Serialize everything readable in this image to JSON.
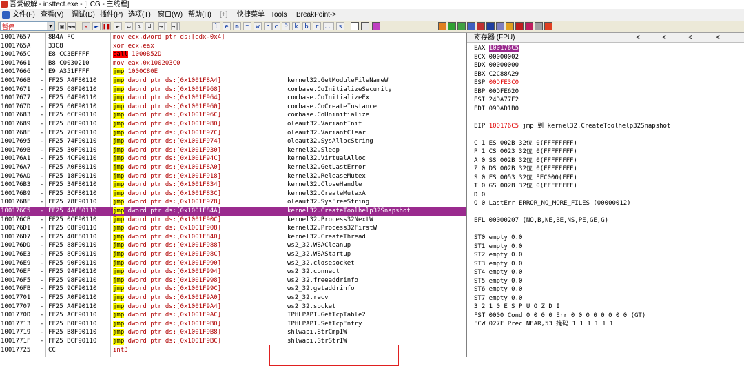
{
  "window": {
    "title": "吾爱破解 - insttect.exe - [LCG - 主线程]"
  },
  "menu": [
    "文件(F)",
    "查看(V)",
    "调试(D)",
    "插件(P)",
    "选项(T)",
    "窗口(W)",
    "帮助(H)",
    "[+]",
    "快捷菜单",
    "Tools",
    "BreakPoint->"
  ],
  "toolbar": {
    "combo_value": "暂停",
    "buttons": [
      "◄◄",
      "✕",
      "►",
      "❚❚",
      "►",
      "↵",
      "↴",
      "↲",
      "→|",
      "→|"
    ],
    "letter_buttons": [
      "l",
      "e",
      "m",
      "t",
      "w",
      "h",
      "c",
      "P",
      "k",
      "b",
      "r",
      "...",
      "s"
    ]
  },
  "code": {
    "rows": [
      {
        "addr": "10017657",
        "mk": "",
        "hex": "8B4A FC",
        "op": "mov",
        "args": " ecx,dword ptr ds:[edx-0x4]",
        "cmt": "",
        "op_class": "mov"
      },
      {
        "addr": "1001765A",
        "mk": "",
        "hex": "33C8",
        "op": "xor",
        "args": " ecx,eax",
        "cmt": "",
        "op_class": "mov"
      },
      {
        "addr": "1001765C",
        "mk": "",
        "hex": "E8 CC3EFFFF",
        "op": "call",
        "args": " 1000B52D",
        "cmt": "",
        "op_class": "call"
      },
      {
        "addr": "10017661",
        "mk": "",
        "hex": "B8 C0030210",
        "op": "mov",
        "args": " eax,0x100203C0",
        "cmt": "",
        "op_class": "mov"
      },
      {
        "addr": "10017666",
        "mk": "^",
        "hex": "E9 A351FFFF",
        "op": "jmp",
        "args": " 1000C80E",
        "cmt": "",
        "op_class": "jmp"
      },
      {
        "addr": "1001766B",
        "mk": "-",
        "hex": "FF25 A4F80110",
        "op": "jmp",
        "args": " dword ptr ds:[0x1001F8A4]",
        "cmt": "kernel32.GetModuleFileNameW",
        "op_class": "jmp"
      },
      {
        "addr": "10017671",
        "mk": "-",
        "hex": "FF25 68F90110",
        "op": "jmp",
        "args": " dword ptr ds:[0x1001F968]",
        "cmt": "combase.CoInitializeSecurity",
        "op_class": "jmp"
      },
      {
        "addr": "10017677",
        "mk": "-",
        "hex": "FF25 64F90110",
        "op": "jmp",
        "args": " dword ptr ds:[0x1001F964]",
        "cmt": "combase.CoInitializeEx",
        "op_class": "jmp"
      },
      {
        "addr": "1001767D",
        "mk": "-",
        "hex": "FF25 60F90110",
        "op": "jmp",
        "args": " dword ptr ds:[0x1001F960]",
        "cmt": "combase.CoCreateInstance",
        "op_class": "jmp"
      },
      {
        "addr": "10017683",
        "mk": "-",
        "hex": "FF25 6CF90110",
        "op": "jmp",
        "args": " dword ptr ds:[0x1001F96C]",
        "cmt": "combase.CoUninitialize",
        "op_class": "jmp"
      },
      {
        "addr": "10017689",
        "mk": "-",
        "hex": "FF25 80F90110",
        "op": "jmp",
        "args": " dword ptr ds:[0x1001F980]",
        "cmt": "oleaut32.VariantInit",
        "op_class": "jmp"
      },
      {
        "addr": "1001768F",
        "mk": "-",
        "hex": "FF25 7CF90110",
        "op": "jmp",
        "args": " dword ptr ds:[0x1001F97C]",
        "cmt": "oleaut32.VariantClear",
        "op_class": "jmp"
      },
      {
        "addr": "10017695",
        "mk": "-",
        "hex": "FF25 74F90110",
        "op": "jmp",
        "args": " dword ptr ds:[0x1001F974]",
        "cmt": "oleaut32.SysAllocString",
        "op_class": "jmp"
      },
      {
        "addr": "1001769B",
        "mk": "-",
        "hex": "FF25 30F90110",
        "op": "jmp",
        "args": " dword ptr ds:[0x1001F930]",
        "cmt": "kernel32.Sleep",
        "op_class": "jmp"
      },
      {
        "addr": "100176A1",
        "mk": "-",
        "hex": "FF25 4CF90110",
        "op": "jmp",
        "args": " dword ptr ds:[0x1001F94C]",
        "cmt": "kernel32.VirtualAlloc",
        "op_class": "jmp"
      },
      {
        "addr": "100176A7",
        "mk": "-",
        "hex": "FF25 A0F80110",
        "op": "jmp",
        "args": " dword ptr ds:[0x1001F8A0]",
        "cmt": "kernel32.GetLastError",
        "op_class": "jmp"
      },
      {
        "addr": "100176AD",
        "mk": "-",
        "hex": "FF25 18F90110",
        "op": "jmp",
        "args": " dword ptr ds:[0x1001F918]",
        "cmt": "kernel32.ReleaseMutex",
        "op_class": "jmp"
      },
      {
        "addr": "100176B3",
        "mk": "-",
        "hex": "FF25 34F80110",
        "op": "jmp",
        "args": " dword ptr ds:[0x1001F834]",
        "cmt": "kernel32.CloseHandle",
        "op_class": "jmp"
      },
      {
        "addr": "100176B9",
        "mk": "-",
        "hex": "FF25 3CF80110",
        "op": "jmp",
        "args": " dword ptr ds:[0x1001F83C]",
        "cmt": "kernel32.CreateMutexA",
        "op_class": "jmp"
      },
      {
        "addr": "100176BF",
        "mk": "-",
        "hex": "FF25 78F90110",
        "op": "jmp",
        "args": " dword ptr ds:[0x1001F978]",
        "cmt": "oleaut32.SysFreeString",
        "op_class": "jmp"
      },
      {
        "addr": "100176C5",
        "mk": "-",
        "hex": "FF25 4AF80110",
        "op": "jmp",
        "args": " dword ptr ds:[0x1001F84A]",
        "cmt": "kernel32.CreateToolhelp32Snapshot",
        "op_class": "jmp",
        "selected": true
      },
      {
        "addr": "100176CB",
        "mk": "-",
        "hex": "FF25 0CF90110",
        "op": "jmp",
        "args": " dword ptr ds:[0x1001F90C]",
        "cmt": "kernel32.Process32NextW",
        "op_class": "jmp"
      },
      {
        "addr": "100176D1",
        "mk": "-",
        "hex": "FF25 08F90110",
        "op": "jmp",
        "args": " dword ptr ds:[0x1001F908]",
        "cmt": "kernel32.Process32FirstW",
        "op_class": "jmp"
      },
      {
        "addr": "100176D7",
        "mk": "-",
        "hex": "FF25 40F80110",
        "op": "jmp",
        "args": " dword ptr ds:[0x1001F840]",
        "cmt": "kernel32.CreateThread",
        "op_class": "jmp"
      },
      {
        "addr": "100176DD",
        "mk": "-",
        "hex": "FF25 88F90110",
        "op": "jmp",
        "args": " dword ptr ds:[0x1001F988]",
        "cmt": "ws2_32.WSACleanup",
        "op_class": "jmp"
      },
      {
        "addr": "100176E3",
        "mk": "-",
        "hex": "FF25 8CF90110",
        "op": "jmp",
        "args": " dword ptr ds:[0x1001F98C]",
        "cmt": "ws2_32.WSAStartup",
        "op_class": "jmp"
      },
      {
        "addr": "100176E9",
        "mk": "-",
        "hex": "FF25 90F90110",
        "op": "jmp",
        "args": " dword ptr ds:[0x1001F990]",
        "cmt": "ws2_32.closesocket",
        "op_class": "jmp"
      },
      {
        "addr": "100176EF",
        "mk": "-",
        "hex": "FF25 94F90110",
        "op": "jmp",
        "args": " dword ptr ds:[0x1001F994]",
        "cmt": "ws2_32.connect",
        "op_class": "jmp"
      },
      {
        "addr": "100176F5",
        "mk": "-",
        "hex": "FF25 98F90110",
        "op": "jmp",
        "args": " dword ptr ds:[0x1001F998]",
        "cmt": "ws2_32.freeaddrinfo",
        "op_class": "jmp"
      },
      {
        "addr": "100176FB",
        "mk": "-",
        "hex": "FF25 9CF90110",
        "op": "jmp",
        "args": " dword ptr ds:[0x1001F99C]",
        "cmt": "ws2_32.getaddrinfo",
        "op_class": "jmp"
      },
      {
        "addr": "10017701",
        "mk": "-",
        "hex": "FF25 A0F90110",
        "op": "jmp",
        "args": " dword ptr ds:[0x1001F9A0]",
        "cmt": "ws2_32.recv",
        "op_class": "jmp"
      },
      {
        "addr": "10017707",
        "mk": "-",
        "hex": "FF25 A4F90110",
        "op": "jmp",
        "args": " dword ptr ds:[0x1001F9A4]",
        "cmt": "ws2_32.socket",
        "op_class": "jmp"
      },
      {
        "addr": "1001770D",
        "mk": "-",
        "hex": "FF25 ACF90110",
        "op": "jmp",
        "args": " dword ptr ds:[0x1001F9AC]",
        "cmt": "IPHLPAPI.GetTcpTable2",
        "op_class": "jmp"
      },
      {
        "addr": "10017713",
        "mk": "-",
        "hex": "FF25 B0F90110",
        "op": "jmp",
        "args": " dword ptr ds:[0x1001F9B0]",
        "cmt": "IPHLPAPI.SetTcpEntry",
        "op_class": "jmp"
      },
      {
        "addr": "10017719",
        "mk": "-",
        "hex": "FF25 B8F90110",
        "op": "jmp",
        "args": " dword ptr ds:[0x1001F9B8]",
        "cmt": "shlwapi.StrCmpIW",
        "op_class": "jmp"
      },
      {
        "addr": "1001771F",
        "mk": "-",
        "hex": "FF25 BCF90110",
        "op": "jmp",
        "args": " dword ptr ds:[0x1001F9BC]",
        "cmt": "shlwapi.StrStrIW",
        "op_class": "jmp"
      },
      {
        "addr": "10017725",
        "mk": "",
        "hex": "CC",
        "op": "int3",
        "args": "",
        "cmt": "",
        "op_class": "mov"
      }
    ]
  },
  "registers": {
    "header": "寄存器 (FPU)",
    "lines": [
      {
        "lead": "EAX ",
        "hl": "100176C5",
        "tail": ""
      },
      {
        "lead": "ECX 00000002",
        "hl": "",
        "tail": ""
      },
      {
        "lead": "EDX 00000000",
        "hl": "",
        "tail": ""
      },
      {
        "lead": "EBX C2C88A29",
        "hl": "",
        "tail": ""
      },
      {
        "lead": "ESP ",
        "red": "00DFE3C0",
        "tail": ""
      },
      {
        "lead": "EBP 00DFE620",
        "hl": "",
        "tail": ""
      },
      {
        "lead": "ESI 24DA77F2",
        "hl": "",
        "tail": ""
      },
      {
        "lead": "EDI 09DAD1B0",
        "hl": "",
        "tail": ""
      },
      {
        "lead": "",
        "hl": "",
        "tail": ""
      },
      {
        "lead": "EIP ",
        "red": "100176C5",
        "tail": " jmp 到 kernel32.CreateToolhelp32Snapshot"
      },
      {
        "lead": "",
        "hl": "",
        "tail": ""
      },
      {
        "lead": "C 1  ES 002B 32位 0(FFFFFFFF)",
        "hl": "",
        "tail": ""
      },
      {
        "lead": "P 1  CS 0023 32位 0(FFFFFFFF)",
        "hl": "",
        "tail": ""
      },
      {
        "lead": "A 0  SS 002B 32位 0(FFFFFFFF)",
        "hl": "",
        "tail": ""
      },
      {
        "lead": "Z 0  DS 002B 32位 0(FFFFFFFF)",
        "hl": "",
        "tail": ""
      },
      {
        "lead": "S 0  FS 0053 32位 EEC000(FFF)",
        "hl": "",
        "tail": ""
      },
      {
        "lead": "T 0  GS 002B 32位 0(FFFFFFFF)",
        "hl": "",
        "tail": ""
      },
      {
        "lead": "D 0",
        "hl": "",
        "tail": ""
      },
      {
        "lead": "O 0  LastErr ERROR_NO_MORE_FILES (00000012)",
        "hl": "",
        "tail": ""
      },
      {
        "lead": "",
        "hl": "",
        "tail": ""
      },
      {
        "lead": "EFL 00000207 (NO,B,NE,BE,NS,PE,GE,G)",
        "hl": "",
        "tail": ""
      },
      {
        "lead": "",
        "hl": "",
        "tail": ""
      },
      {
        "lead": "ST0 empty 0.0",
        "hl": "",
        "tail": ""
      },
      {
        "lead": "ST1 empty 0.0",
        "hl": "",
        "tail": ""
      },
      {
        "lead": "ST2 empty 0.0",
        "hl": "",
        "tail": ""
      },
      {
        "lead": "ST3 empty 0.0",
        "hl": "",
        "tail": ""
      },
      {
        "lead": "ST4 empty 0.0",
        "hl": "",
        "tail": ""
      },
      {
        "lead": "ST5 empty 0.0",
        "hl": "",
        "tail": ""
      },
      {
        "lead": "ST6 empty 0.0",
        "hl": "",
        "tail": ""
      },
      {
        "lead": "ST7 empty 0.0",
        "hl": "",
        "tail": ""
      },
      {
        "lead": "               3 2 1 0      E S P U O Z D I",
        "hl": "",
        "tail": ""
      },
      {
        "lead": "FST 0000  Cond 0 0 0 0  Err 0 0 0 0 0 0 0 0  (GT)",
        "hl": "",
        "tail": ""
      },
      {
        "lead": "FCW 027F  Prec NEAR,53  掩码    1 1 1 1 1 1",
        "hl": "",
        "tail": ""
      }
    ]
  },
  "colors": {
    "selection": "#9a2a8e",
    "jmp_highlight": "#ffff00",
    "call_highlight": "#ff0000",
    "annotation_box": "#e02020"
  }
}
